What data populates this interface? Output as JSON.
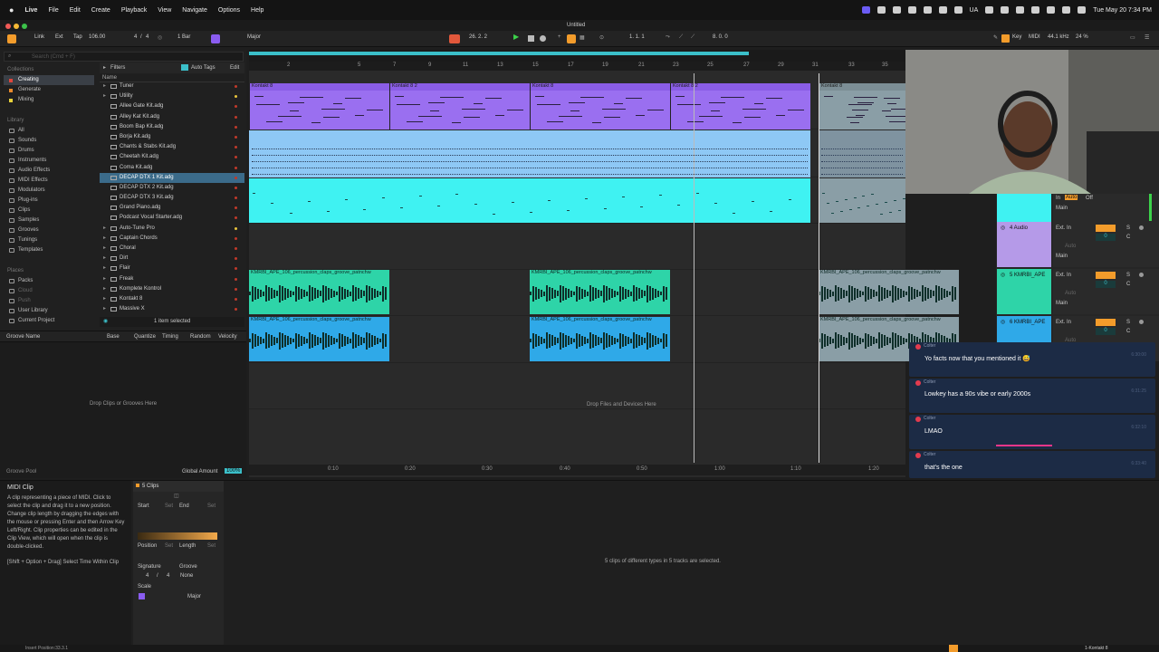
{
  "menubar": {
    "apple": "",
    "items": [
      "Live",
      "File",
      "Edit",
      "Create",
      "Playback",
      "View",
      "Navigate",
      "Options",
      "Help"
    ],
    "clock": "Tue May 20  7:34 PM",
    "country": "UA"
  },
  "window": {
    "title": "Untitled"
  },
  "toolbar": {
    "link": "Link",
    "ext": "Ext",
    "tap": "Tap",
    "tempo": "106.00",
    "sig_num": "4",
    "sig_den": "4",
    "quant": "1 Bar",
    "scale_mode": "Major",
    "position": "26.  2.  2",
    "loop_start": "1.  1.  1",
    "loop_len": "8.  0.  0",
    "key": "Key",
    "midi": "MIDI",
    "samplerate": "44.1 kHz",
    "cpu": "24 %"
  },
  "browser": {
    "search_placeholder": "Search (Cmd + F)",
    "collections_label": "Collections",
    "collections": [
      {
        "label": "Creating",
        "color": "#e0463b"
      },
      {
        "label": "Generate",
        "color": "#e98a2c"
      },
      {
        "label": "Mixing",
        "color": "#e8d23b"
      }
    ],
    "library_label": "Library",
    "library": [
      "All",
      "Sounds",
      "Drums",
      "Instruments",
      "Audio Effects",
      "MIDI Effects",
      "Modulators",
      "Plug-ins",
      "Clips",
      "Samples",
      "Grooves",
      "Tunings",
      "Templates"
    ],
    "places_label": "Places",
    "places": [
      "Packs",
      "Cloud",
      "Push",
      "User Library",
      "Current Project"
    ],
    "filters": "Filters",
    "auto_tags": "Auto Tags",
    "edit": "Edit",
    "name_header": "Name",
    "files": [
      {
        "name": "Tuner",
        "type": "folder"
      },
      {
        "name": "Utility",
        "type": "folder",
        "dot": "#e8c43b"
      },
      {
        "name": "Allee Gate Kit.adg",
        "type": "file"
      },
      {
        "name": "Alley Kat Kit.adg",
        "type": "file"
      },
      {
        "name": "Boom Bap Kit.adg",
        "type": "file"
      },
      {
        "name": "Borja Kit.adg",
        "type": "file"
      },
      {
        "name": "Chants & Stabs Kit.adg",
        "type": "file"
      },
      {
        "name": "Cheetah Kit.adg",
        "type": "file"
      },
      {
        "name": "Coma Kit.adg",
        "type": "file"
      },
      {
        "name": "DECAP DTX 1 Kit.adg",
        "type": "file",
        "sel": true
      },
      {
        "name": "DECAP DTX 2 Kit.adg",
        "type": "file"
      },
      {
        "name": "DECAP DTX 3 Kit.adg",
        "type": "file"
      },
      {
        "name": "Grand Piano.adg",
        "type": "file"
      },
      {
        "name": "Podcast Vocal Starter.adg",
        "type": "file"
      },
      {
        "name": "Auto-Tune Pro",
        "type": "folder",
        "dot": "#e8c43b"
      },
      {
        "name": "Captain Chords",
        "type": "folder"
      },
      {
        "name": "Choral",
        "type": "folder"
      },
      {
        "name": "Dirt",
        "type": "folder"
      },
      {
        "name": "Flair",
        "type": "folder"
      },
      {
        "name": "Freak",
        "type": "folder"
      },
      {
        "name": "Komplete Kontrol",
        "type": "folder"
      },
      {
        "name": "Kontakt 8",
        "type": "folder"
      },
      {
        "name": "Massive X",
        "type": "folder"
      }
    ],
    "status": "1 item selected"
  },
  "groove": {
    "headers": [
      "Groove Name",
      "Base",
      "Quantize",
      "Timing",
      "Random",
      "Velocity"
    ],
    "drop_text": "Drop Clips or Grooves Here",
    "pool_label": "Groove Pool",
    "global_amount_label": "Global Amount",
    "global_amount": "100%"
  },
  "arrangement": {
    "bars": [
      "2",
      "5",
      "7",
      "9",
      "11",
      "13",
      "15",
      "17",
      "19",
      "21",
      "23",
      "25",
      "27",
      "29",
      "31",
      "33",
      "35",
      "37"
    ],
    "times": [
      "0:10",
      "0:20",
      "0:30",
      "0:40",
      "0:50",
      "1:00",
      "1:10",
      "1:20"
    ],
    "midi_clips": [
      "Kontakt 8",
      "Kontakt 8 2",
      "Kontakt 8",
      "Kontakt 8 2",
      "Kontakt 8"
    ],
    "audio_clip_name": "KMRBI_APE_106_percussion_claps_groove_patnchw",
    "drop_text": "Drop Files and Devices Here"
  },
  "mixer": {
    "tracks": [
      {
        "name": "4 Audio",
        "color": "#b59ae8",
        "input": "Ext. In"
      },
      {
        "name": "5 KMRBI_APE",
        "color": "#2ed4a8",
        "input": "Ext. In"
      },
      {
        "name": "6 KMRBI_APE",
        "color": "#2fa9e8",
        "input": "Ext. In"
      }
    ],
    "in": "In",
    "auto": "Auto",
    "off": "Off",
    "main": "Main",
    "s": "S",
    "c": "C",
    "zero": "0"
  },
  "chat": [
    {
      "name": "Colter",
      "text": "Yo facts now that you mentioned it 😅",
      "time": "6:30:00"
    },
    {
      "name": "Colter",
      "text": "Lowkey has a 90s vibe or early 2000s",
      "time": "6:31:25"
    },
    {
      "name": "Colter",
      "text": "LMAO",
      "time": "6:32:10"
    },
    {
      "name": "Colter",
      "text": "that's the one",
      "time": "6:33:40"
    }
  ],
  "clipview": {
    "title": "MIDI Clip",
    "help": "A clip representing a piece of MIDI. Click to select the clip and drag it to a new position. Change clip length by dragging the edges with the mouse or pressing Enter and then Arrow Key Left/Right. Clip properties can be edited in the Clip View, which will open when the clip is double-clicked.",
    "shortcut": "[Shift + Option + Drag] Select Time Within Clip",
    "clips_label": "5 Clips",
    "start": "Start",
    "end": "End",
    "set": "Set",
    "position": "Position",
    "length": "Length",
    "signature": "Signature",
    "groove": "Groove",
    "sig_num": "4",
    "sig_den": "4",
    "groove_val": "None",
    "scale": "Scale",
    "scale_mode": "Major",
    "info": "5 clips of different types in 5 tracks are selected."
  },
  "statusbar": {
    "insert": "Insert Position:33.3.1",
    "track": "1-Kontakt 8"
  }
}
